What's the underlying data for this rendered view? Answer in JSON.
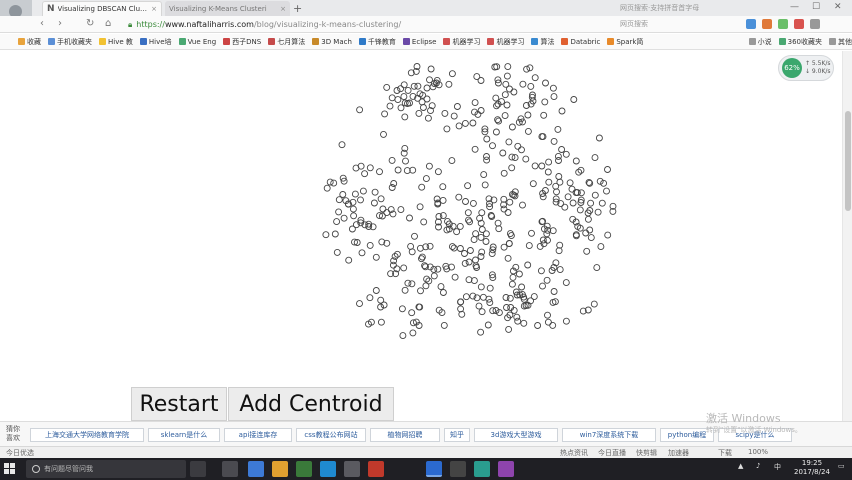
{
  "browser": {
    "active_tab_title": "Visualizing DBSCAN Clusteri",
    "inactive_tab_title": "Visualizing K-Means Clusteri",
    "favicon_letter": "N",
    "tab_close": "×",
    "new_tab": "+",
    "url_protocol": "https://",
    "url_host": "www.naftaliharris.com",
    "url_path": "/blog/visualizing-k-means-clustering/",
    "search_hint": "网页搜索·支持拼音首字母",
    "addr_hint": "网页搜索"
  },
  "bookmarks": [
    {
      "label": "收藏",
      "color": "#e8a33c"
    },
    {
      "label": "手机收藏夹",
      "color": "#5b8fd6"
    },
    {
      "label": "Hive 教",
      "color": "#f2c232"
    },
    {
      "label": "Hive培",
      "color": "#3a6fc2"
    },
    {
      "label": "Vue Eng",
      "color": "#4aa872"
    },
    {
      "label": "西子DNS",
      "color": "#cc4444"
    },
    {
      "label": "七月算法",
      "color": "#c54a4a"
    },
    {
      "label": "3D Mach",
      "color": "#c88a2a"
    },
    {
      "label": "千锋教育",
      "color": "#2f7ac8"
    },
    {
      "label": "Eclipse",
      "color": "#6b4aa8"
    },
    {
      "label": "机器学习",
      "color": "#d05050"
    },
    {
      "label": "机器学习",
      "color": "#d05050"
    },
    {
      "label": "算法",
      "color": "#3a8ad0"
    },
    {
      "label": "Databric",
      "color": "#e06030"
    },
    {
      "label": "Spark简",
      "color": "#e88a2a"
    }
  ],
  "bookmarks_right": [
    {
      "label": "小说",
      "color": "#999999"
    },
    {
      "label": "360收藏夹",
      "color": "#4aa872"
    },
    {
      "label": "其他",
      "color": "#999999"
    }
  ],
  "speed_widget": {
    "percent": "62%",
    "up": "↑ 5.5K/s",
    "down": "↓ 9.0K/s"
  },
  "buttons": {
    "restart": "Restart",
    "add_centroid": "Add Centroid"
  },
  "bottom_nav": {
    "label_line1": "猜你",
    "label_line2": "喜欢",
    "links": [
      "上海交通大学网络教育学院",
      "sklearn是什么",
      "api接连库存",
      "css教程公布网站",
      "植物网招聘",
      "知乎",
      "3d游戏大型游戏",
      "win7深度系统下载",
      "python编程",
      "scipy是什么"
    ]
  },
  "watermark": {
    "line1": "激活 Windows",
    "line2": "转到\"设置\"以激活 Windows。"
  },
  "status": {
    "left": "今日优选",
    "items": [
      "热点资讯",
      "今日直播",
      "快剪辑",
      "加速器",
      "下载",
      "100%"
    ]
  },
  "taskbar": {
    "search_placeholder": "有问题尽管问我",
    "time": "19:25",
    "date": "2017/8/24",
    "tray_lang": "中"
  },
  "chart_data": {
    "type": "scatter",
    "title": "",
    "description": "k-means demo canvas with unlabeled hollow-circle data points",
    "marker": "hollow circle",
    "point_color": "#444444",
    "clusters": [
      {
        "center": [
          412,
          93
        ],
        "spread": [
          22,
          20
        ],
        "count": 45
      },
      {
        "center": [
          512,
          108
        ],
        "spread": [
          33,
          26
        ],
        "count": 70
      },
      {
        "center": [
          368,
          203
        ],
        "spread": [
          26,
          28
        ],
        "count": 55
      },
      {
        "center": [
          488,
          215
        ],
        "spread": [
          58,
          42
        ],
        "count": 140
      },
      {
        "center": [
          575,
          195
        ],
        "spread": [
          23,
          28
        ],
        "count": 45
      },
      {
        "center": [
          418,
          290
        ],
        "spread": [
          33,
          28
        ],
        "count": 55
      },
      {
        "center": [
          520,
          293
        ],
        "spread": [
          37,
          28
        ],
        "count": 65
      }
    ]
  }
}
